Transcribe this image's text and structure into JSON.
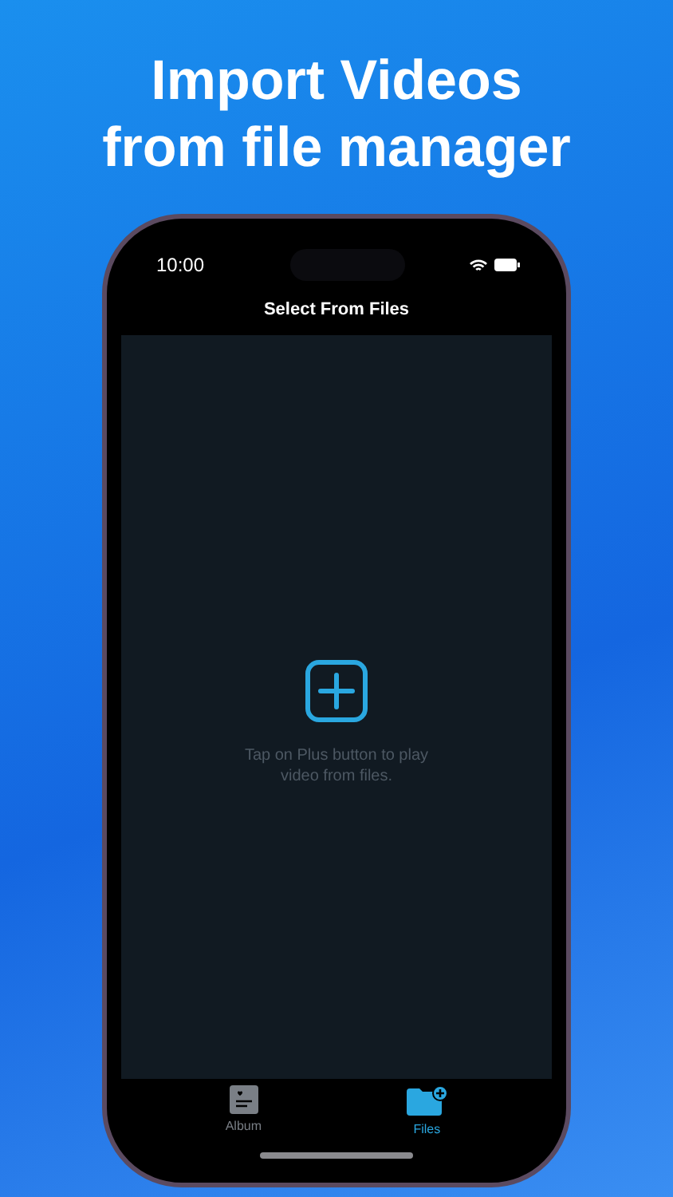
{
  "headline": [
    "Import Videos",
    "from file manager"
  ],
  "status_bar": {
    "time": "10:00"
  },
  "nav": {
    "title": "Select From Files"
  },
  "empty_state": {
    "message": "Tap on Plus button to play video from files."
  },
  "tabs": [
    {
      "label": "Album",
      "kind": "album",
      "selected": false
    },
    {
      "label": "Files",
      "kind": "files",
      "selected": true
    }
  ]
}
